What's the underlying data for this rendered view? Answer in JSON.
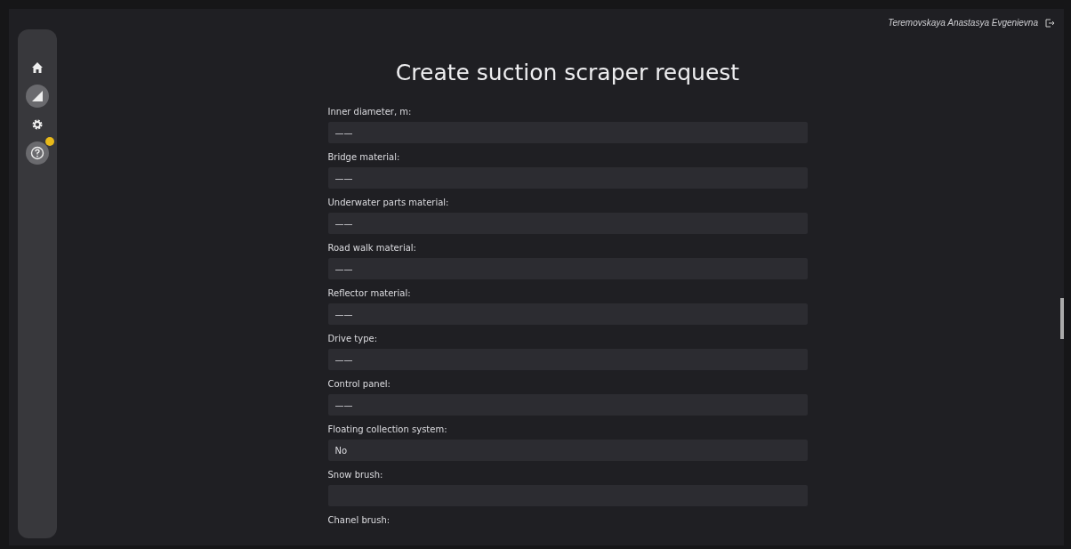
{
  "user": {
    "name": "Teremovskaya Anastasya Evgenievna"
  },
  "nav": [
    {
      "kind": "home",
      "highlighted": false,
      "badge": false
    },
    {
      "kind": "chart",
      "highlighted": true,
      "badge": false
    },
    {
      "kind": "settings",
      "highlighted": false,
      "badge": false
    },
    {
      "kind": "help",
      "highlighted": true,
      "badge": true
    }
  ],
  "title": "Create suction scraper request",
  "fields": [
    {
      "label": "Inner diameter, m:",
      "kind": "select",
      "value": "——"
    },
    {
      "label": "Bridge material:",
      "kind": "select",
      "value": "——"
    },
    {
      "label": "Underwater parts material:",
      "kind": "select",
      "value": "——"
    },
    {
      "label": "Road walk material:",
      "kind": "select",
      "value": "——"
    },
    {
      "label": "Reflector material:",
      "kind": "select",
      "value": "——"
    },
    {
      "label": "Drive type:",
      "kind": "select",
      "value": "——"
    },
    {
      "label": "Control panel:",
      "kind": "select",
      "value": "——"
    },
    {
      "label": "Floating collection system:",
      "kind": "select",
      "value": "No"
    },
    {
      "label": "Snow brush:",
      "kind": "select"
    },
    {
      "label": "Chanel brush:",
      "kind": "label"
    }
  ]
}
